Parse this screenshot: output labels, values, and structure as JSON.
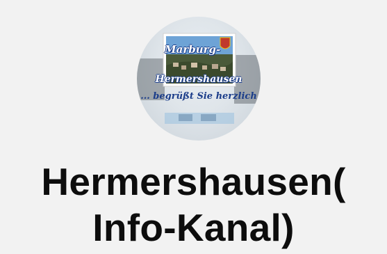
{
  "profile": {
    "avatar_caption": {
      "line1": "Marburg-",
      "line2": "Hermershausen",
      "line3": "... begrüßt Sie herzlich"
    },
    "title_line1": "Hermershausen(",
    "title_line2": "Info-Kanal)"
  },
  "colors": {
    "background": "#f2f2f2",
    "title": "#0d0d0d",
    "avatar_text": "#1b3d8a"
  }
}
